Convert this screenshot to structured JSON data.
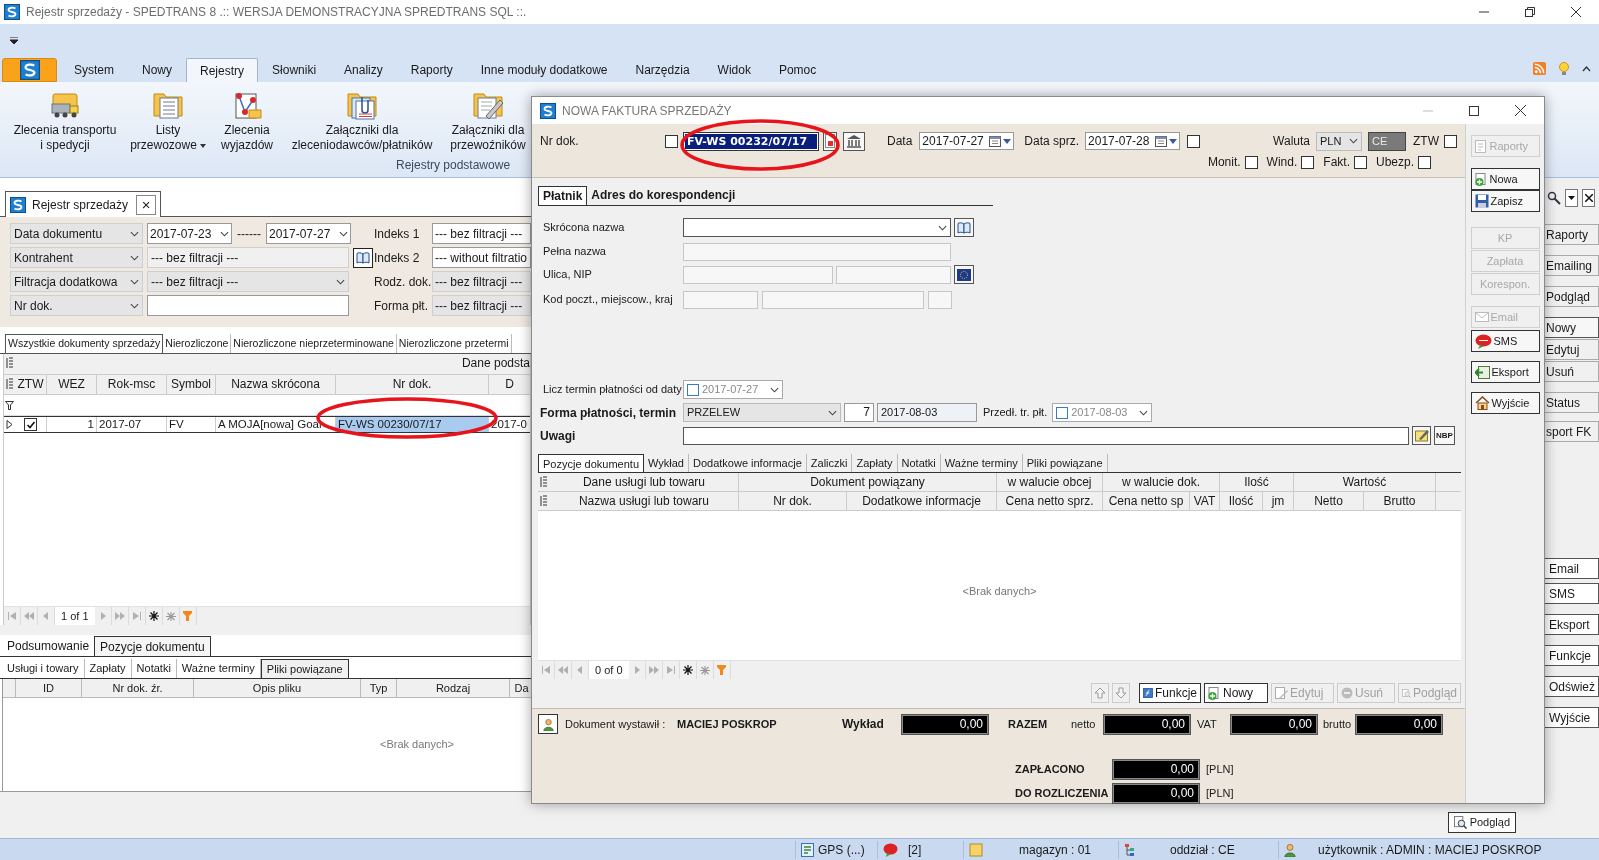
{
  "window": {
    "title": "Rejestr sprzedaży - SPEDTRANS 8 .:: WERSJA DEMONSTRACYJNA SPREDTRANS SQL ::."
  },
  "ribbon_tabs": [
    {
      "label": "System",
      "selected": false
    },
    {
      "label": "Nowy",
      "selected": false
    },
    {
      "label": "Rejestry",
      "selected": true
    },
    {
      "label": "Słowniki",
      "selected": false
    },
    {
      "label": "Analizy",
      "selected": false
    },
    {
      "label": "Raporty",
      "selected": false
    },
    {
      "label": "Inne moduły dodatkowe",
      "selected": false
    },
    {
      "label": "Narzędzia",
      "selected": false
    },
    {
      "label": "Widok",
      "selected": false
    },
    {
      "label": "Pomoc",
      "selected": false
    }
  ],
  "ribbon_group": {
    "label": "Rejestry podstawowe",
    "buttons": [
      {
        "lines": [
          "Zlecenia transportu",
          "i spedycji"
        ],
        "dropdown": false
      },
      {
        "lines": [
          "Listy",
          "przewozowe"
        ],
        "dropdown": true
      },
      {
        "lines": [
          "Zlecenia",
          "wyjazdów"
        ],
        "dropdown": false
      },
      {
        "lines": [
          "Załączniki dla",
          "zleceniodawców/płatników"
        ],
        "dropdown": false
      },
      {
        "lines": [
          "Załączniki dla",
          "przewoźników"
        ],
        "dropdown": false
      }
    ]
  },
  "document_tab": {
    "label": "Rejestr sprzedaży",
    "close": "×"
  },
  "filters": [
    {
      "field": "Data dokumentu",
      "kind": "date_range",
      "from": "2017-07-23",
      "separator": "------",
      "to": "2017-07-27",
      "side_label": "Indeks 1",
      "side_value": "--- bez filtracji ---",
      "side_disabled": false
    },
    {
      "field": "Kontrahent",
      "kind": "lookup",
      "value": "--- bez filtracji ---",
      "side_label": "Indeks 2",
      "side_value": "--- without filtratio",
      "side_disabled": false
    },
    {
      "field": "Filtracja dodatkowa",
      "kind": "dropdown",
      "value": "--- bez filtracji ---",
      "side_label": "Rodz. dok.",
      "side_value": "--- bez filtracji ---",
      "side_disabled": true
    },
    {
      "field": "Nr dok.",
      "kind": "text",
      "side_label": "Forma płt.",
      "side_value": "--- bez filtracji ---",
      "side_disabled": true
    }
  ],
  "register_tabs": [
    {
      "label": "Wszystkie dokumenty sprzedaży",
      "selected": true
    },
    {
      "label": "Nierozliczone",
      "selected": false
    },
    {
      "label": "Nierozliczone nieprzeterminowane",
      "selected": false
    },
    {
      "label": "Nierozliczone przetermi",
      "selected": false
    }
  ],
  "register_grid": {
    "band": "Dane podsta",
    "columns": [
      "ZTW",
      "WEZ",
      "Rok-msc",
      "Symbol",
      "Nazwa skrócona",
      "Nr dok.",
      "D"
    ],
    "rows": [
      {
        "cells": [
          {
            "kind": "checkbox",
            "checked": true,
            "selected": false
          },
          {
            "kind": "text",
            "text": "1",
            "selected": false
          },
          {
            "kind": "text",
            "text": "2017-07",
            "selected": false
          },
          {
            "kind": "text",
            "text": "FV",
            "selected": false
          },
          {
            "kind": "text",
            "text": "A MOJA[nowa] Goar",
            "selected": false
          },
          {
            "kind": "text",
            "text": "FV-WS 00230/07/17",
            "selected": true
          },
          {
            "kind": "text",
            "text": "2017-0",
            "selected": false
          }
        ]
      }
    ],
    "pager": "1 of 1"
  },
  "detail_tabs": [
    {
      "label": "Podsumowanie",
      "selected": false
    },
    {
      "label": "Pozycje dokumentu",
      "selected": true
    }
  ],
  "detail_subtabs": [
    {
      "label": "Usługi i towary",
      "selected": false
    },
    {
      "label": "Zapłaty",
      "selected": false
    },
    {
      "label": "Notatki",
      "selected": false
    },
    {
      "label": "Ważne terminy",
      "selected": false
    },
    {
      "label": "Pliki powiązane",
      "selected": true
    }
  ],
  "files_grid": {
    "columns": [
      "ID",
      "Nr dok. źr.",
      "Opis pliku",
      "Typ",
      "Rodzaj",
      "Da"
    ],
    "empty_text": "<Brak danych>"
  },
  "side_buttons_top": [
    {
      "label": "Raporty",
      "selected": false
    },
    {
      "label": "Emailing",
      "selected": false
    },
    {
      "label": "Podgląd",
      "selected": false
    },
    {
      "label": "Nowy",
      "selected": true
    },
    {
      "label": "Edytuj",
      "selected": false
    },
    {
      "label": "Usuń",
      "selected": false
    },
    {
      "label": "Status",
      "selected": false
    },
    {
      "label": "sport FK",
      "selected": false
    }
  ],
  "side_buttons_bottom": [
    "Email",
    "SMS",
    "Eksport",
    "Funkcje",
    "Odśwież",
    "Wyjście"
  ],
  "preview_button": "Podgląd",
  "status_bar": [
    "GPS (...)",
    "[2]",
    "magazyn : 01",
    "oddział : CE",
    "użytkownik : ADMIN : MACIEJ POSKROP"
  ],
  "dialog": {
    "title": "NOWA FAKTURA SPRZEDAŻY",
    "nr_dok": {
      "label": "Nr dok.",
      "checked": false,
      "value": "FV-WS 00232/07/17"
    },
    "data": {
      "label": "Data",
      "value": "2017-07-27"
    },
    "data_sprz": {
      "label": "Data sprz.",
      "value": "2017-07-28",
      "checked": false
    },
    "waluta": {
      "label": "Waluta",
      "value": "PLN",
      "rate": "CE"
    },
    "flags": [
      {
        "label": "ZTW",
        "checked": false
      },
      {
        "label": "Monit.",
        "checked": false
      },
      {
        "label": "Wind.",
        "checked": false
      },
      {
        "label": "Fakt.",
        "checked": false
      },
      {
        "label": "Ubezp.",
        "checked": false
      }
    ],
    "actions": [
      {
        "label": "Raporty",
        "disabled": true
      },
      {
        "label": "Nowa",
        "disabled": false
      },
      {
        "label": "Zapisz",
        "disabled": false
      },
      {
        "label": "KP",
        "disabled": true
      },
      {
        "label": "Zapłata",
        "disabled": true
      },
      {
        "label": "Korespon.",
        "disabled": true
      },
      {
        "label": "Email",
        "disabled": true
      },
      {
        "label": "SMS",
        "disabled": false
      },
      {
        "label": "Eksport",
        "disabled": false
      },
      {
        "label": "Wyjście",
        "disabled": false
      }
    ],
    "party_tabs": [
      {
        "label": "Płatnik",
        "selected": true
      },
      {
        "label": "Adres do korespondencji",
        "selected": false
      }
    ],
    "party_fields": [
      "Skrócona nazwa",
      "Pełna nazwa",
      "Ulica, NIP",
      "Kod poczt., miejscow., kraj"
    ],
    "payment": {
      "from_date_label": "Licz termin płatności od daty",
      "from_date_checked": false,
      "from_date": "2017-07-27",
      "method_label": "Forma płatności, termin",
      "method": "PRZELEW",
      "days": "7",
      "due": "2017-08-03",
      "extend_label": "Przedł. tr. płt.",
      "extend_checked": false,
      "extend_date": "2017-08-03"
    },
    "remarks_label": "Uwagi",
    "nbp_button": "NBP",
    "item_tabs": [
      {
        "label": "Pozycje dokumentu",
        "selected": true
      },
      {
        "label": "Wykład",
        "selected": false
      },
      {
        "label": "Dodatkowe informacje",
        "selected": false
      },
      {
        "label": "Zaliczki",
        "selected": false
      },
      {
        "label": "Zapłaty",
        "selected": false
      },
      {
        "label": "Notatki",
        "selected": false
      },
      {
        "label": "Ważne terminy",
        "selected": false
      },
      {
        "label": "Pliki powiązane",
        "selected": false
      }
    ],
    "items_grid": {
      "bands": [
        "Dane usługi lub towaru",
        "Dokument powiązany",
        "w walucie obcej",
        "w walucie dok.",
        "Ilość",
        "Wartość"
      ],
      "columns": [
        "Nazwa usługi lub towaru",
        "Nr dok.",
        "Dodatkowe informacje",
        "Cena netto sprz.",
        "Cena netto sp",
        "VAT",
        "Ilość",
        "jm",
        "Netto",
        "Brutto"
      ],
      "empty_text": "<Brak danych>",
      "pager": "0 of 0"
    },
    "item_buttons": [
      {
        "label": "Funkcje",
        "disabled": false
      },
      {
        "label": "Nowy",
        "disabled": false
      },
      {
        "label": "Edytuj",
        "disabled": true
      },
      {
        "label": "Usuń",
        "disabled": true
      },
      {
        "label": "Podgląd",
        "disabled": true
      }
    ],
    "footer": {
      "issued_label": "Dokument wystawił :",
      "issued_by": "MACIEJ POSKROP",
      "wyklad_label": "Wykład",
      "wyklad": "0,00",
      "total_label": "RAZEM",
      "netto_label": "netto",
      "netto": "0,00",
      "vat_label": "VAT",
      "vat": "0,00",
      "brutto_label": "brutto",
      "brutto": "0,00",
      "paid_label": "ZAPŁACONO",
      "paid": "0,00",
      "paid_currency": "[PLN]",
      "due_label": "DO ROZLICZENIA",
      "due": "0,00",
      "due_currency": "[PLN]"
    }
  }
}
